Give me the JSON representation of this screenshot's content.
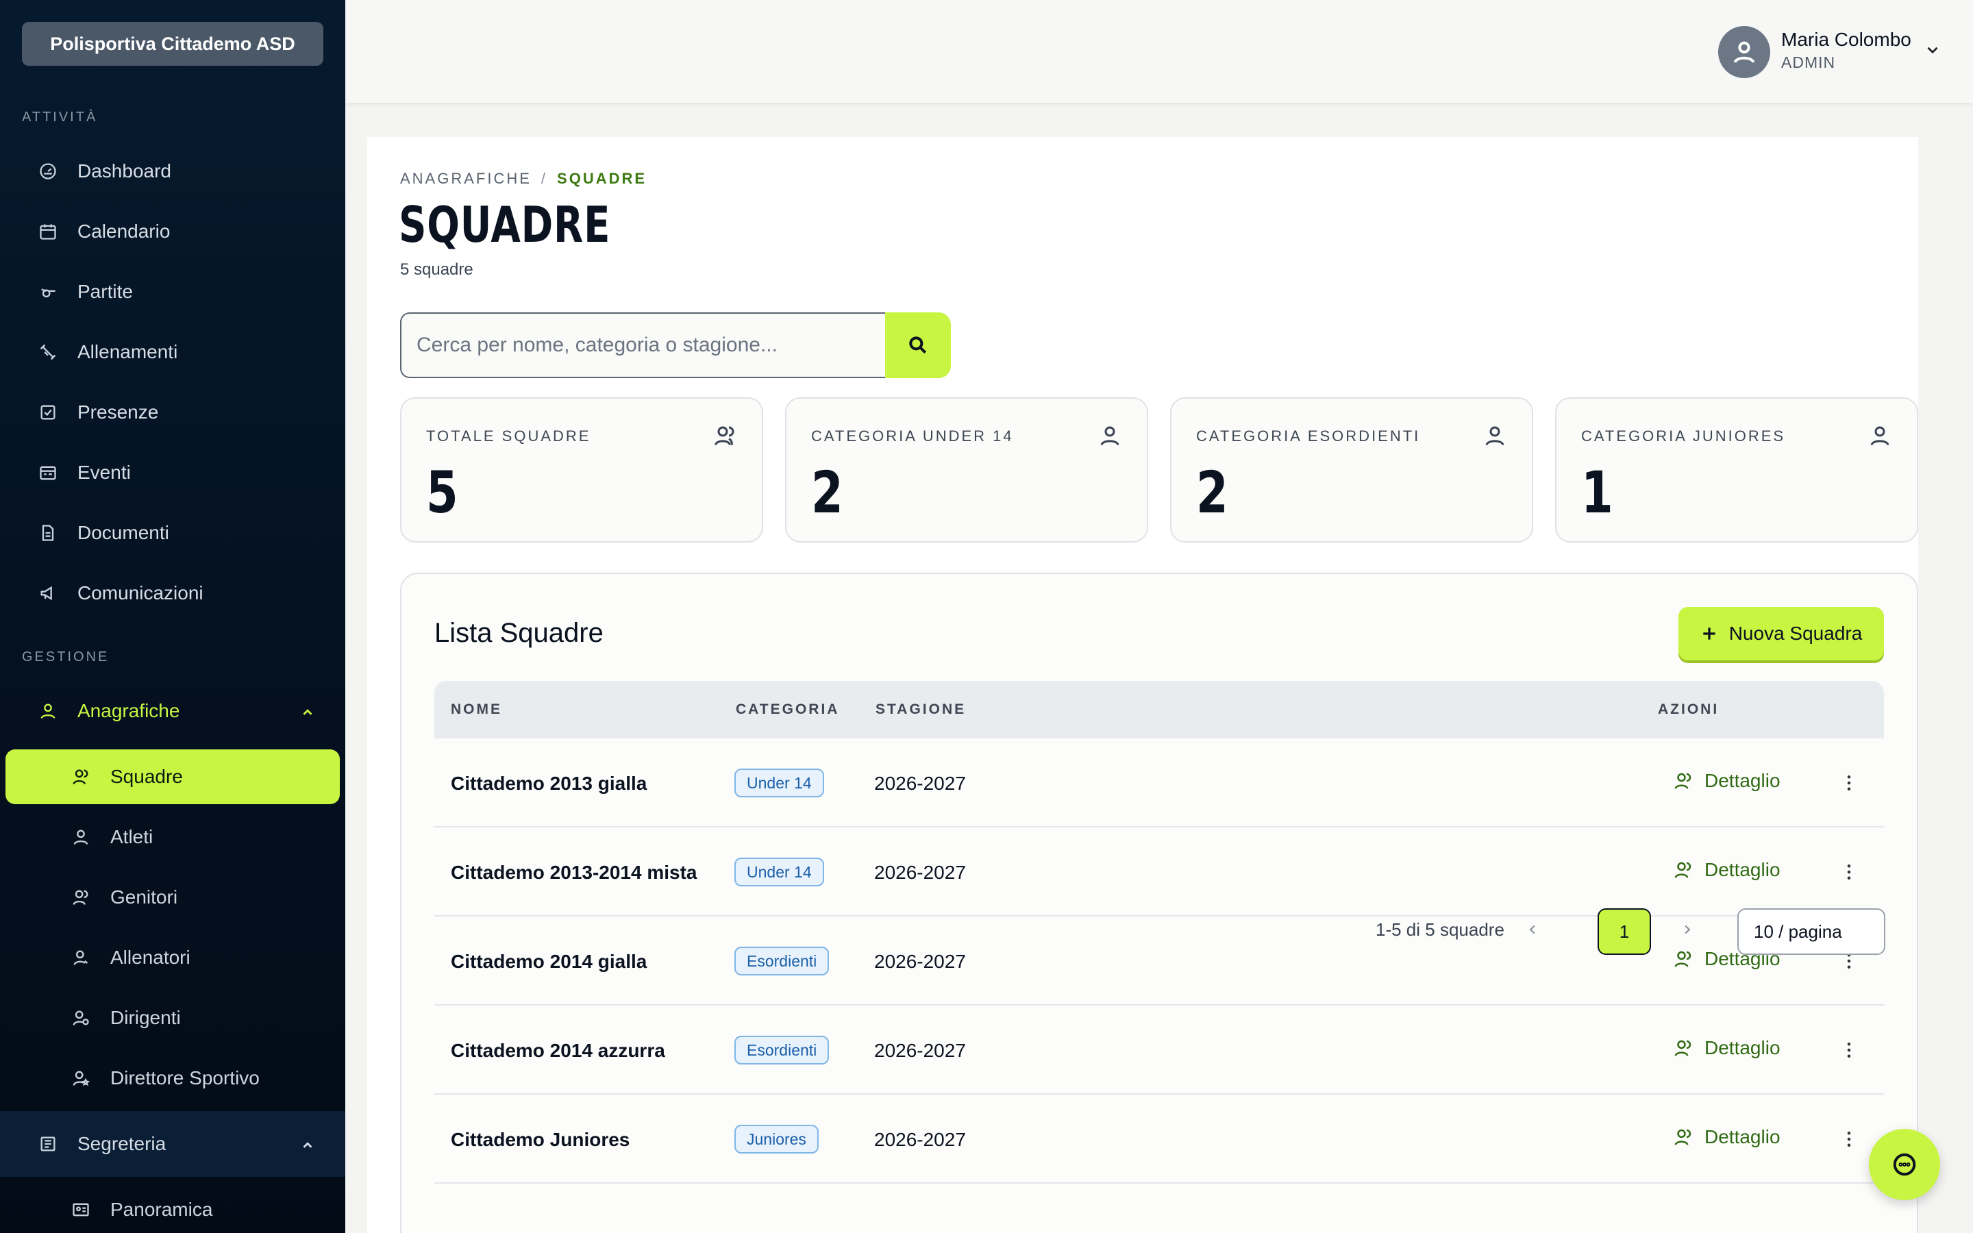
{
  "org": {
    "name": "Polisportiva Cittademo ASD"
  },
  "sidebar": {
    "sections": [
      {
        "label": "ATTIVITÀ"
      },
      {
        "label": "GESTIONE"
      }
    ],
    "items": [
      {
        "label": "Dashboard",
        "icon": "gauge-icon"
      },
      {
        "label": "Calendario",
        "icon": "calendar-icon"
      },
      {
        "label": "Partite",
        "icon": "whistle-icon"
      },
      {
        "label": "Allenamenti",
        "icon": "dumbbell-icon"
      },
      {
        "label": "Presenze",
        "icon": "checkbox-icon"
      },
      {
        "label": "Eventi",
        "icon": "calendar-event-icon"
      },
      {
        "label": "Documenti",
        "icon": "document-icon"
      },
      {
        "label": "Comunicazioni",
        "icon": "megaphone-icon"
      }
    ],
    "anagrafiche": {
      "label": "Anagrafiche",
      "expanded": true,
      "items": [
        {
          "label": "Squadre",
          "active": true,
          "icon": "users-icon"
        },
        {
          "label": "Atleti",
          "icon": "user-icon"
        },
        {
          "label": "Genitori",
          "icon": "users-icon"
        },
        {
          "label": "Allenatori",
          "icon": "user-edit-icon"
        },
        {
          "label": "Dirigenti",
          "icon": "user-gear-icon"
        },
        {
          "label": "Direttore Sportivo",
          "icon": "user-star-icon"
        }
      ]
    },
    "segreteria": {
      "label": "Segreteria",
      "expanded": true,
      "items": [
        {
          "label": "Panoramica",
          "icon": "id-card-icon"
        }
      ]
    }
  },
  "user": {
    "name": "Maria Colombo",
    "role": "ADMIN"
  },
  "breadcrumb": {
    "parent": "ANAGRAFICHE",
    "separator": "/",
    "current": "SQUADRE"
  },
  "page": {
    "title": "SQUADRE",
    "subtitle": "5 squadre"
  },
  "search": {
    "placeholder": "Cerca per nome, categoria o stagione...",
    "value": ""
  },
  "stats": [
    {
      "label": "TOTALE SQUADRE",
      "value": "5",
      "icon": "users-icon"
    },
    {
      "label": "CATEGORIA UNDER 14",
      "value": "2",
      "icon": "user-icon"
    },
    {
      "label": "CATEGORIA ESORDIENTI",
      "value": "2",
      "icon": "user-icon"
    },
    {
      "label": "CATEGORIA JUNIORES",
      "value": "1",
      "icon": "user-icon"
    }
  ],
  "list": {
    "title": "Lista Squadre",
    "new_button": "Nuova Squadra",
    "columns": {
      "name": "NOME",
      "category": "CATEGORIA",
      "season": "STAGIONE",
      "actions": "AZIONI"
    },
    "rows": [
      {
        "name": "Cittademo 2013 gialla",
        "category": "Under 14",
        "season": "2026-2027",
        "action": "Dettaglio"
      },
      {
        "name": "Cittademo 2013-2014 mista",
        "category": "Under 14",
        "season": "2026-2027",
        "action": "Dettaglio"
      },
      {
        "name": "Cittademo 2014 gialla",
        "category": "Esordienti",
        "season": "2026-2027",
        "action": "Dettaglio"
      },
      {
        "name": "Cittademo 2014 azzurra",
        "category": "Esordienti",
        "season": "2026-2027",
        "action": "Dettaglio"
      },
      {
        "name": "Cittademo Juniores",
        "category": "Juniores",
        "season": "2026-2027",
        "action": "Dettaglio"
      }
    ]
  },
  "pagination": {
    "info": "1-5 di 5 squadre",
    "current_page": "1",
    "page_size": "10 / pagina"
  },
  "colors": {
    "accent": "#c8f542",
    "sidebar_bg": "#061a2e",
    "link_green": "#2f6a12",
    "badge_blue": "#1a5fa8"
  }
}
